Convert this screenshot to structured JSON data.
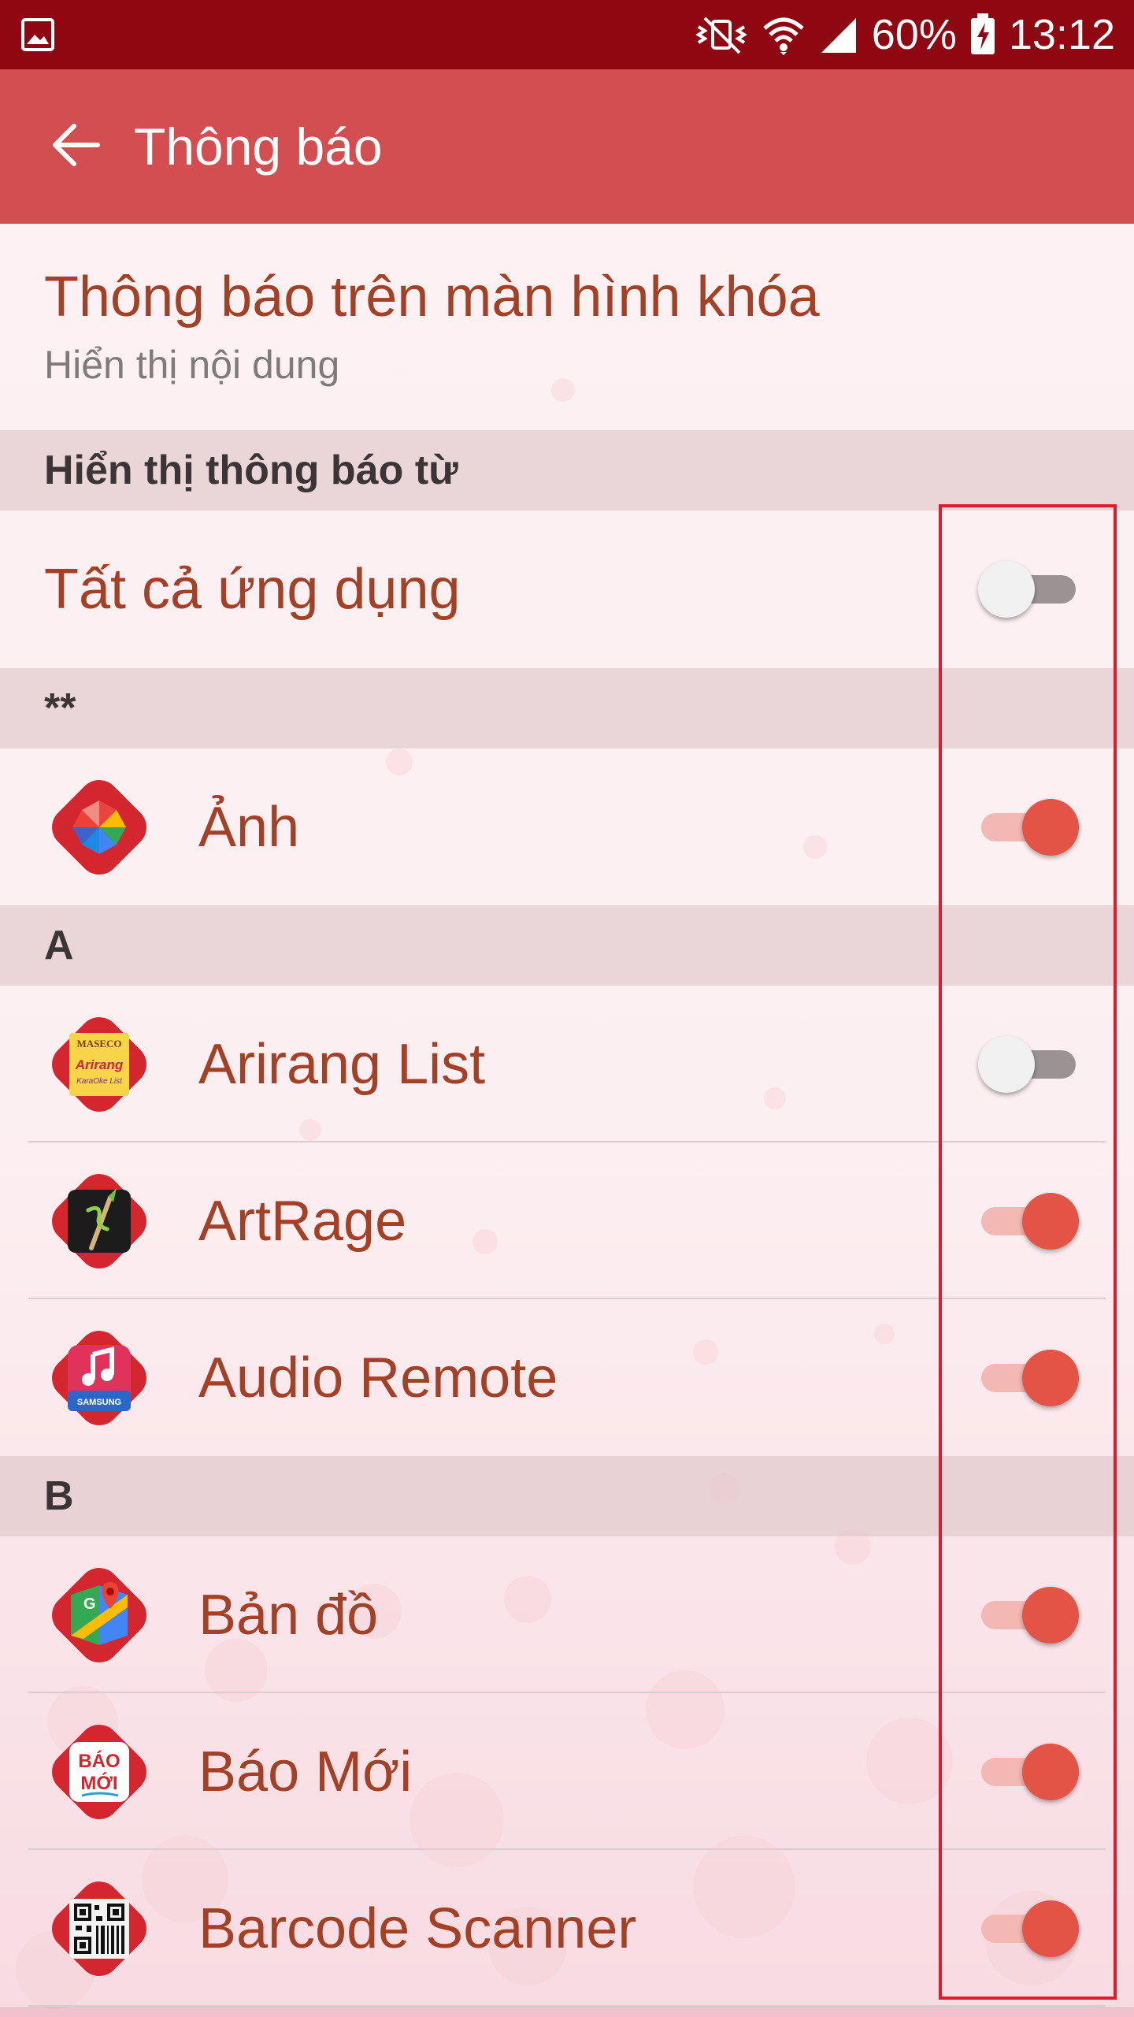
{
  "status_bar": {
    "battery": "60%",
    "time": "13:12",
    "icons": [
      "image-notification-icon",
      "vibrate-mute-icon",
      "wifi-icon",
      "signal-icon",
      "battery-charging-icon"
    ],
    "background": "#8f0710"
  },
  "header": {
    "title": "Thông báo",
    "back_icon": "arrow-left-icon",
    "background": "#d24e50"
  },
  "lock_screen": {
    "title": "Thông báo trên màn hình khóa",
    "subtitle": "Hiển thị nội dung"
  },
  "section_show_from": {
    "label": "Hiển thị thông báo từ"
  },
  "all_apps": {
    "label": "Tất cả ứng dụng",
    "enabled": false
  },
  "groups": [
    {
      "header": "**",
      "apps": [
        {
          "label": "Ảnh",
          "icon": "photos-icon",
          "enabled": true
        }
      ]
    },
    {
      "header": "A",
      "apps": [
        {
          "label": "Arirang List",
          "icon": "arirang-list-icon",
          "enabled": false
        },
        {
          "label": "ArtRage",
          "icon": "artrage-icon",
          "enabled": true
        },
        {
          "label": "Audio Remote",
          "icon": "audio-remote-icon",
          "enabled": true
        }
      ]
    },
    {
      "header": "B",
      "apps": [
        {
          "label": "Bản đồ",
          "icon": "maps-icon",
          "enabled": true
        },
        {
          "label": "Báo Mới",
          "icon": "bao-moi-icon",
          "enabled": true
        },
        {
          "label": "Barcode Scanner",
          "icon": "barcode-scanner-icon",
          "enabled": true
        }
      ]
    }
  ],
  "icon_text": {
    "arirang_top": "MASECO",
    "arirang_mid": "Arirang",
    "arirang_bottom": "KaraOke List",
    "audio_remote": "SAMSUNG",
    "bao_moi_line1": "BÁO",
    "bao_moi_line2": "MỚI"
  },
  "colors": {
    "accent": "#e45446",
    "label_text": "#a34025",
    "highlight_border": "#e11b2a"
  }
}
